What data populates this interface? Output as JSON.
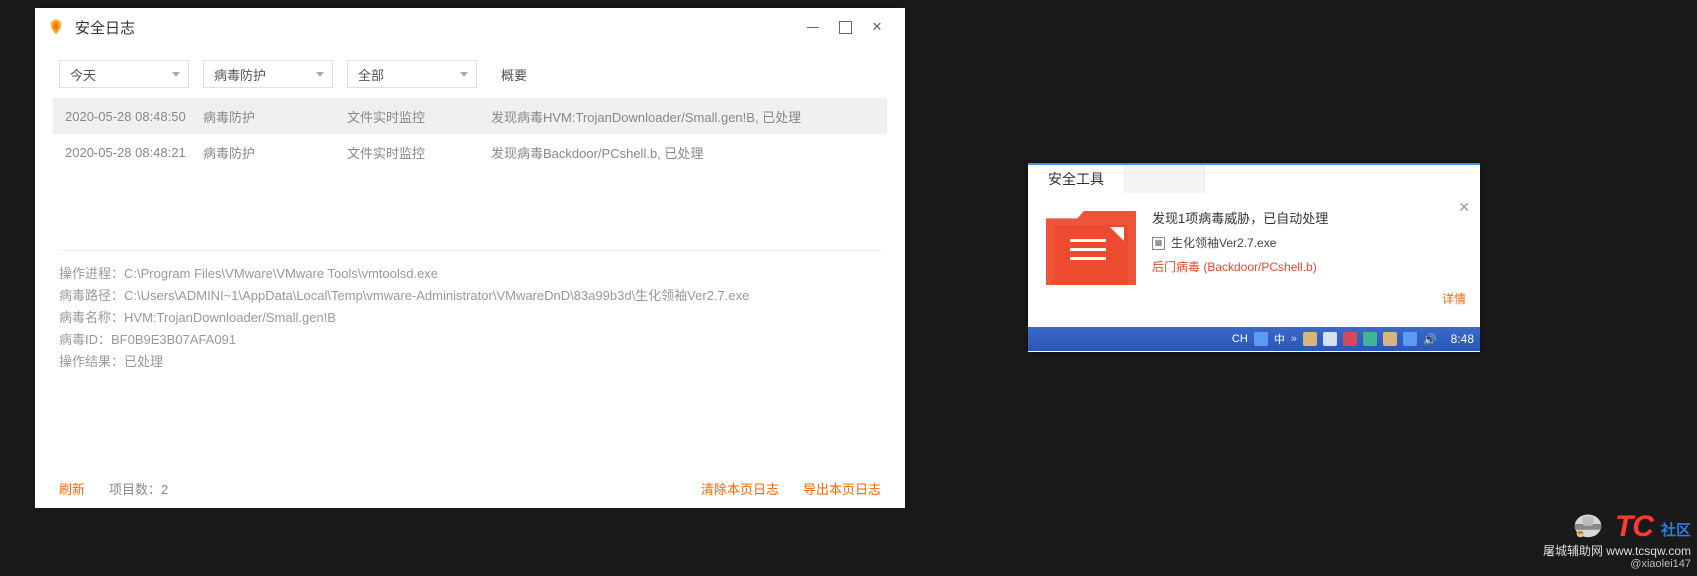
{
  "window": {
    "title": "安全日志"
  },
  "filters": {
    "date": "今天",
    "type": "病毒防护",
    "scope": "全部",
    "summary_label": "概要"
  },
  "rows": [
    {
      "time": "2020-05-28 08:48:50",
      "type": "病毒防护",
      "method": "文件实时监控",
      "summary": "发现病毒HVM:TrojanDownloader/Small.gen!B, 已处理"
    },
    {
      "time": "2020-05-28 08:48:21",
      "type": "病毒防护",
      "method": "文件实时监控",
      "summary": "发现病毒Backdoor/PCshell.b, 已处理"
    }
  ],
  "details": {
    "process_label": "操作进程：",
    "process": "C:\\Program Files\\VMware\\VMware Tools\\vmtoolsd.exe",
    "path_label": "病毒路径：",
    "path": "C:\\Users\\ADMINI~1\\AppData\\Local\\Temp\\vmware-Administrator\\VMwareDnD\\83a99b3d\\生化领袖Ver2.7.exe",
    "name_label": "病毒名称：",
    "name": "HVM:TrojanDownloader/Small.gen!B",
    "id_label": "病毒ID：",
    "id": "BF0B9E3B07AFA091",
    "result_label": "操作结果：",
    "result": "已处理"
  },
  "footer": {
    "refresh": "刷新",
    "count_label": "项目数：",
    "count": "2",
    "clear": "清除本页日志",
    "export": "导出本页日志"
  },
  "popup": {
    "tab": "安全工具",
    "title": "发现1项病毒威胁，已自动处理",
    "file": "生化领袖Ver2.7.exe",
    "threat": "后门病毒 (Backdoor/PCshell.b)",
    "more": "详情"
  },
  "taskbar": {
    "lang": "CH",
    "ime": "中",
    "clock": "8:48"
  },
  "watermark": {
    "logo": "TC",
    "cn": "社区",
    "line1": "屠城辅助网 www.tcsqw.com",
    "line2": "@xiaolei147"
  }
}
